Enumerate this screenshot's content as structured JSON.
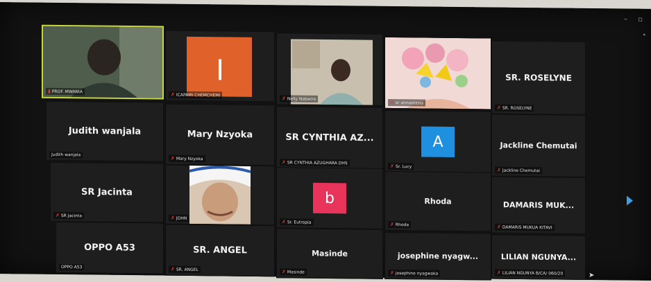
{
  "window": {
    "controls": "– ▫"
  },
  "tiles": [
    {
      "name": "",
      "label": "PROF. MWANIA",
      "muted": false
    },
    {
      "name": "",
      "label": "ICAPAMI CHEMCHEMI",
      "muted": true
    },
    {
      "name": "",
      "label": "Nelly Nabwire",
      "muted": true
    },
    {
      "name": "",
      "label": "sr annastasia",
      "muted": true
    },
    {
      "name": "SR. ROSELYNE",
      "label": "SR. ROSELYNE",
      "muted": true
    },
    {
      "name": "Judith wanjala",
      "label": "Judith wanjala",
      "muted": false
    },
    {
      "name": "Mary Nzyoka",
      "label": "Mary Nzyoka",
      "muted": true
    },
    {
      "name": "SR CYNTHIA AZ...",
      "label": "SR CYNTHIA AZUGHARA DHS",
      "muted": true
    },
    {
      "name": "",
      "label": "Sr. Lucy",
      "muted": true,
      "avatar": "A"
    },
    {
      "name": "Jackline Chemutai",
      "label": "Jackline Chemutai",
      "muted": true
    },
    {
      "name": "SR Jacinta",
      "label": "SR Jacinta",
      "muted": true
    },
    {
      "name": "",
      "label": "JOHN",
      "muted": true
    },
    {
      "name": "",
      "label": "Sr. Eutropia",
      "muted": true,
      "avatar": "b"
    },
    {
      "name": "Rhoda",
      "label": "Rhoda",
      "muted": true
    },
    {
      "name": "DAMARIS MUK...",
      "label": "DAMARIS MUKUA KITAVI",
      "muted": true
    },
    {
      "name": "OPPO A53",
      "label": "OPPO A53",
      "muted": false
    },
    {
      "name": "SR. ANGEL",
      "label": "SR. ANGEL",
      "muted": true
    },
    {
      "name": "Masinde",
      "label": "Masinde",
      "muted": true
    },
    {
      "name": "josephine nyagw...",
      "label": "josephine nyagwoka",
      "muted": true
    },
    {
      "name": "LILIAN NGUNYA...",
      "label": "LILIAN NGUNYA B/CA/ 060/20",
      "muted": true
    }
  ],
  "colors": {
    "avatar_A": "#1f8fe0",
    "avatar_b": "#e8335a",
    "active": "#c8d63a"
  }
}
